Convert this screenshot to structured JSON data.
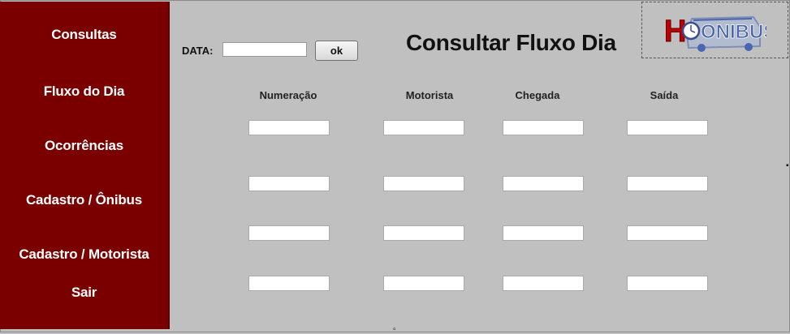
{
  "sidebar": {
    "items": [
      {
        "label": "Consultas"
      },
      {
        "label": "Fluxo do Dia"
      },
      {
        "label": "Ocorrências"
      },
      {
        "label": "Cadastro / Ônibus"
      },
      {
        "label": "Cadastro / Motorista"
      },
      {
        "label": "Sair"
      }
    ]
  },
  "form": {
    "date_label": "DATA:",
    "date_value": "",
    "ok_label": "ok"
  },
  "main": {
    "title": "Consultar Fluxo Dia"
  },
  "table": {
    "columns": [
      "Numeração",
      "Motorista",
      "Chegada",
      "Saída"
    ],
    "rows": [
      [
        "",
        "",
        "",
        ""
      ],
      [
        "",
        "",
        "",
        ""
      ],
      [
        "",
        "",
        "",
        ""
      ],
      [
        "",
        "",
        "",
        ""
      ]
    ]
  },
  "logo": {
    "text": "ONIBUS",
    "initial": "H"
  },
  "colors": {
    "sidebar": "#7a0000",
    "background": "#c0c0c0",
    "logo_blue": "#4a66b0"
  }
}
